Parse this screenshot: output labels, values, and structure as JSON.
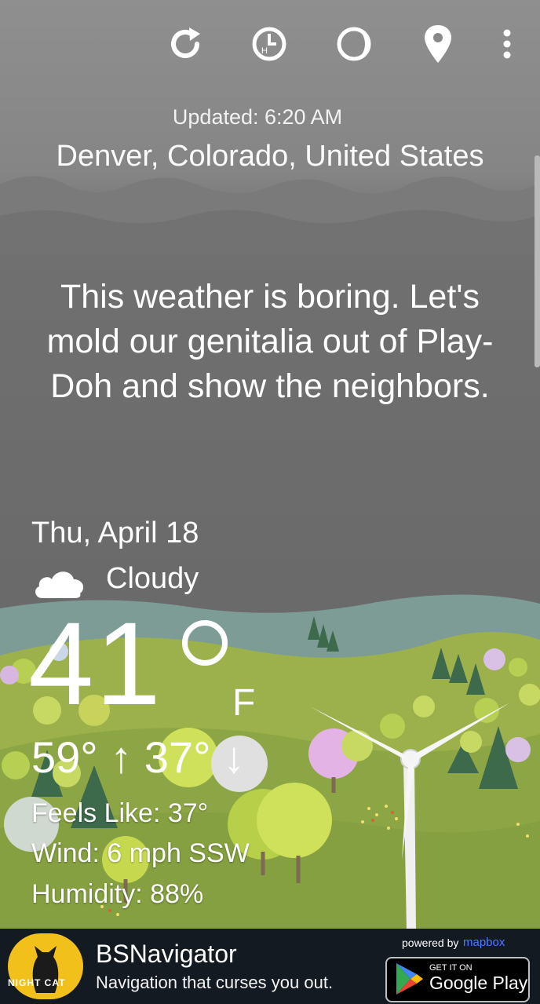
{
  "toolbar": {
    "icons": [
      "refresh-icon",
      "hourly-clock-icon",
      "moon-phase-icon",
      "location-pin-icon",
      "more-vert-icon"
    ]
  },
  "header": {
    "updated": "Updated: 6:20 AM",
    "location": "Denver, Colorado, United States"
  },
  "message": "This weather is boring. Let's mold our genitalia out of Play-Doh and show the neighbors.",
  "forecast": {
    "date": "Thu, April 18",
    "condition": "Cloudy",
    "condition_icon": "cloud-icon",
    "temperature": "41",
    "unit": "F",
    "hi_lo": "59° ↑ 37° ↓",
    "feels_like": "Feels Like: 37°",
    "wind": "Wind: 6 mph SSW",
    "humidity": "Humidity: 88%"
  },
  "ad": {
    "logo_text": "NIGHT CAT",
    "title": "BSNavigator",
    "subtitle": "Navigation that curses you out.",
    "powered_by": "powered by",
    "mapbox": "mapbox",
    "play_get": "GET IT ON",
    "play_store": "Google Play"
  },
  "colors": {
    "sky_top": "#8f8f8f",
    "sky_bottom": "#6a6a6a",
    "hills": "#8fa64a",
    "ad_bg": "#141a22",
    "logo_yellow": "#f2c01a"
  }
}
